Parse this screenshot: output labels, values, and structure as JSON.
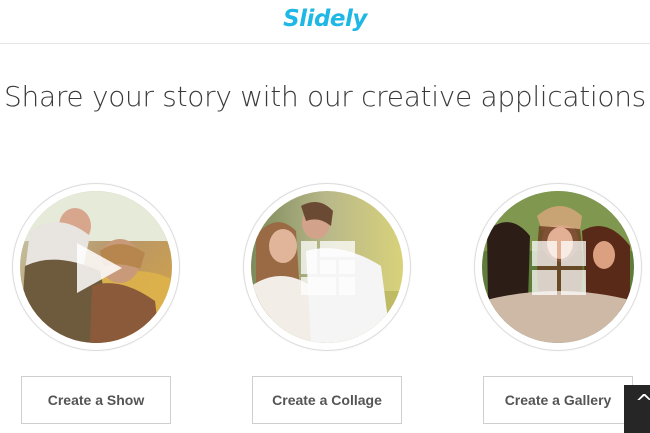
{
  "header": {
    "logo_text": "Slidely",
    "brand_color": "#1fb8e6"
  },
  "main": {
    "headline": "Share your story with our creative applications",
    "cards": [
      {
        "button_label": "Create a Show",
        "icon": "play-icon"
      },
      {
        "button_label": "Create a Collage",
        "icon": "collage-grid-icon"
      },
      {
        "button_label": "Create a Gallery",
        "icon": "gallery-grid-icon"
      }
    ]
  },
  "floating": {
    "scroll_top_icon": "chevron-up-icon",
    "glyph": "^"
  }
}
